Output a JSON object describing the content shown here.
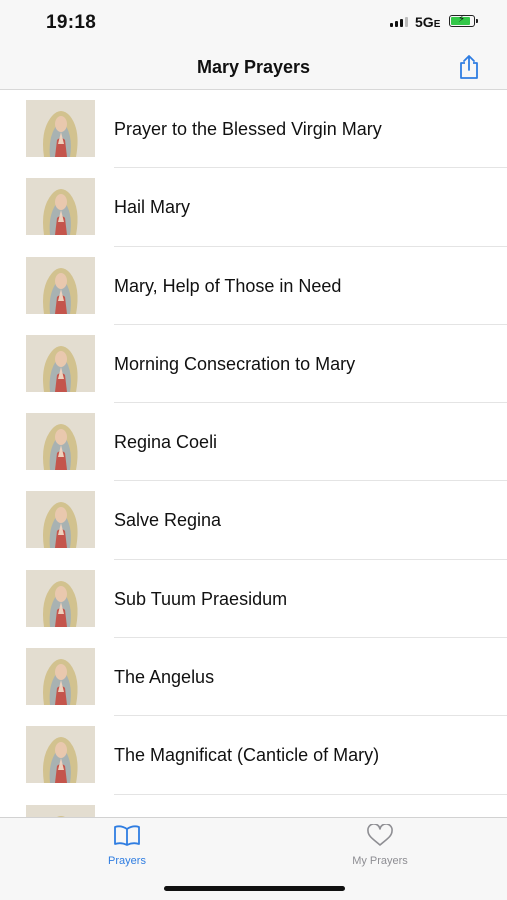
{
  "status_bar": {
    "time": "19:18",
    "network": "5G",
    "network_suffix": "E"
  },
  "nav": {
    "title": "Mary Prayers",
    "share_icon": "share-icon"
  },
  "prayers": [
    "Prayer to the Blessed Virgin Mary",
    "Hail Mary",
    "Mary, Help of Those in Need",
    "Morning Consecration to Mary",
    "Regina Coeli",
    "Salve Regina",
    "Sub Tuum Praesidum",
    "The Angelus",
    "The Magnificat (Canticle of Mary)",
    ""
  ],
  "tabbar": {
    "tabs": [
      {
        "label": "Prayers",
        "icon": "book-icon",
        "selected": true
      },
      {
        "label": "My Prayers",
        "icon": "heart-icon",
        "selected": false
      }
    ]
  },
  "colors": {
    "accent": "#2f7de1",
    "inactive": "#8e8e93",
    "battery": "#33c748"
  }
}
